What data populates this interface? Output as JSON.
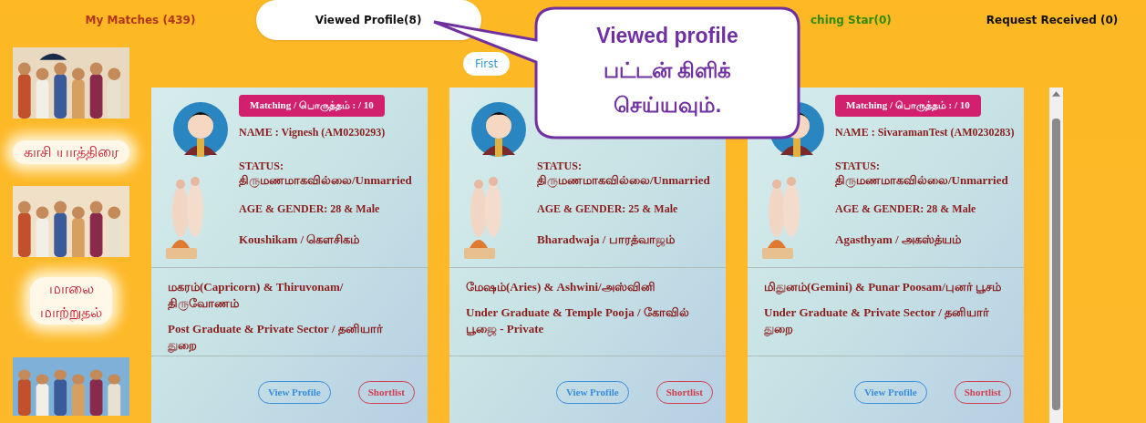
{
  "tabs": [
    {
      "label": "My Matches (439)",
      "selected": false,
      "color": "#b0361c"
    },
    {
      "label": "Viewed Profile(8)",
      "selected": true,
      "color": "#111111"
    },
    {
      "label": "ching Star(0)",
      "selected": false,
      "color": "#2f8a0a",
      "kind": "partial"
    },
    {
      "label": "Request Received (0)",
      "selected": false,
      "color": "#111111"
    }
  ],
  "sidebar": {
    "items": [
      {
        "kind": "picture"
      },
      {
        "caption": "காசி யாத்திரை"
      },
      {
        "kind": "picture"
      },
      {
        "caption": "மாலை மாற்றுதல்"
      },
      {
        "kind": "picture"
      }
    ]
  },
  "pagination": {
    "first": "First"
  },
  "callout": {
    "text": "Viewed profile பட்டன் கிளிக் செய்யவும்."
  },
  "cards": [
    {
      "badge": "Matching / பொருத்தம் : / 10",
      "name": "NAME : Vignesh (AM0230293)",
      "status_label": "STATUS:",
      "status": "திருமணமாகவில்லை/Unmarried",
      "age_gender": "AGE & GENDER: 28 & Male",
      "gothram": "Koushikam / கௌசிகம்",
      "star": "மகரம்(Capricorn) & Thiruvonam/ திருவோணம்",
      "education": "Post Graduate & Private Sector / தனியார் துறை",
      "view": "View Profile",
      "shortlist": "Shortlist"
    },
    {
      "status_label": "STATUS:",
      "status": "திருமணமாகவில்லை/Unmarried",
      "age_gender": "AGE & GENDER: 25 & Male",
      "gothram": "Bharadwaja / பாரத்வாஜம்",
      "star": "மேஷம்(Aries) & Ashwini/அஸ்வினி",
      "education": "Under Graduate & Temple Pooja / கோவில் பூஜை - Private",
      "view": "View Profile",
      "shortlist": "Shortlist"
    },
    {
      "badge": "Matching / பொருத்தம் : / 10",
      "name": "NAME : SivaramanTest (AM0230283)",
      "status_label": "STATUS:",
      "status": "திருமணமாகவில்லை/Unmarried",
      "age_gender": "AGE & GENDER: 28 & Male",
      "gothram": "Agasthyam / அகஸ்த்யம்",
      "star": "மிதுனம்(Gemini) & Punar Poosam/புனர் பூசம்",
      "education": "Under Graduate & Private Sector / தனியார் துறை",
      "view": "View Profile",
      "shortlist": "Shortlist"
    }
  ]
}
